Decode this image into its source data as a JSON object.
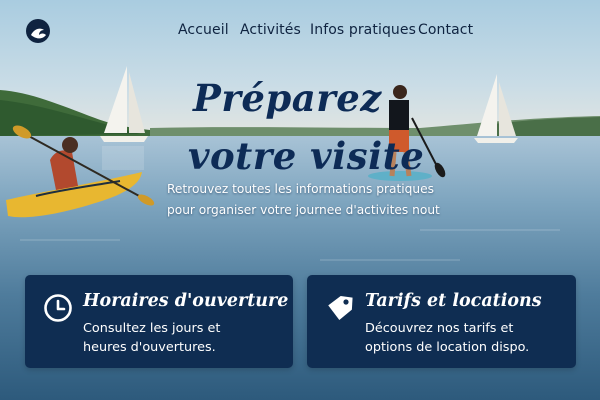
{
  "brand": {
    "logo_icon": "wave-logo-icon",
    "color": "#0f2340"
  },
  "nav": {
    "items": [
      {
        "label": "Accueil"
      },
      {
        "label": "Activités"
      },
      {
        "label": "Infos pratiques"
      },
      {
        "label": "Contact"
      }
    ]
  },
  "hero": {
    "title_line1": "Préparez",
    "title_line2": "votre visite",
    "subtitle_line1": "Retrouvez toutes les informations pratiques",
    "subtitle_line2": "pour organiser votre journee d'activites nout"
  },
  "cards": [
    {
      "icon": "clock-icon",
      "title": "Horaires d'ouverture",
      "text_line1": "Consultez les jours et",
      "text_line2": "heures d'ouvertures."
    },
    {
      "icon": "price-tag-icon",
      "title": "Tarifs et locations",
      "text_line1": "Découvrez nos tarifs et",
      "text_line2": "options de location dispo."
    }
  ],
  "colors": {
    "navy": "#0f2d52",
    "title": "#0d2b56",
    "sky": "#a8cde2",
    "water": "#4d7fa0"
  }
}
